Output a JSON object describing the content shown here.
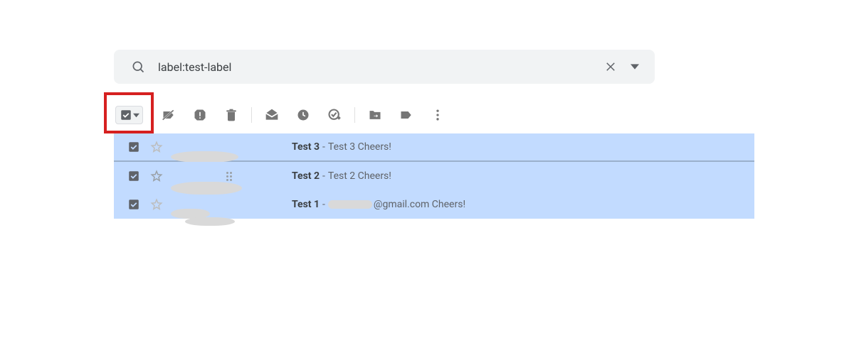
{
  "search": {
    "query": "label:test-label"
  },
  "toolbar": {
    "icons": {
      "remove_label": "remove-label",
      "spam": "report-spam",
      "delete": "delete",
      "mark_read": "mark-as-read",
      "snooze": "snooze",
      "add_task": "add-to-tasks",
      "move": "move-to",
      "labels": "labels",
      "more": "more"
    }
  },
  "rows": [
    {
      "checked": true,
      "starred": false,
      "sender_redacted": true,
      "subject": "Test 3",
      "snippet": "Test 3 Cheers!"
    },
    {
      "checked": true,
      "starred": false,
      "sender_redacted": true,
      "subject": "Test 2",
      "snippet": "Test 2 Cheers!"
    },
    {
      "checked": true,
      "starred": false,
      "sender_redacted": true,
      "subject": "Test 1",
      "snippet_prefix_redacted": true,
      "snippet_suffix": "@gmail.com Cheers!"
    }
  ]
}
